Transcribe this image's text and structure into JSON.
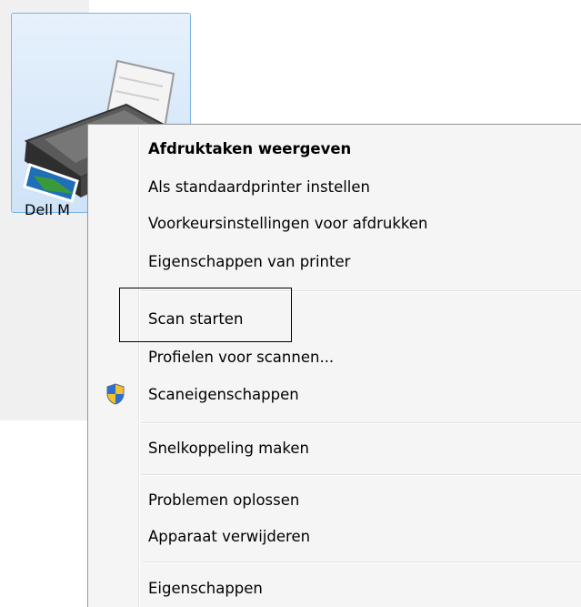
{
  "printer": {
    "label": "Dell M",
    "icon": "printer-icon"
  },
  "menu": {
    "items": [
      {
        "label": "Afdruktaken weergeven",
        "bold": true
      },
      {
        "label": "Als standaardprinter instellen"
      },
      {
        "label": "Voorkeursinstellingen voor afdrukken"
      },
      {
        "label": "Eigenschappen van printer"
      },
      {
        "label": "Scan starten"
      },
      {
        "label": "Profielen voor scannen..."
      },
      {
        "label": "Scaneigenschappen",
        "icon": "uac-shield-icon"
      },
      {
        "label": "Snelkoppeling maken"
      },
      {
        "label": "Problemen oplossen"
      },
      {
        "label": "Apparaat verwijderen"
      },
      {
        "label": "Eigenschappen"
      }
    ]
  },
  "colors": {
    "tile_border": "#7fb4e4",
    "menu_background": "#f5f5f5",
    "annotation_box": "#000000"
  }
}
